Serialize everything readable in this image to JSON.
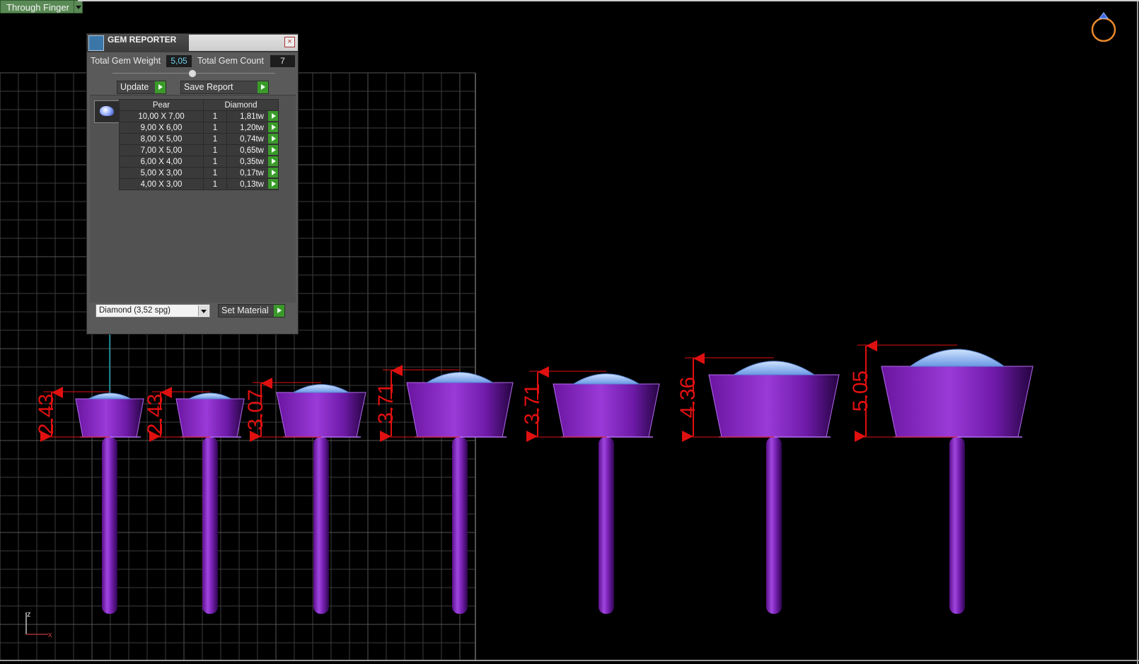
{
  "toolbar": {
    "mode": "Through Finger"
  },
  "panel": {
    "title": "GEM REPORTER",
    "total_weight_label": "Total Gem Weight",
    "total_weight": "5,05",
    "total_count_label": "Total Gem Count",
    "total_count": "7",
    "update_label": "Update",
    "save_report_label": "Save Report",
    "table": {
      "header_shape": "Pear",
      "header_material": "Diamond",
      "rows": [
        {
          "size": "10,00 X 7,00",
          "qty": "1",
          "weight": "1,81tw"
        },
        {
          "size": "9,00 X 6,00",
          "qty": "1",
          "weight": "1,20tw"
        },
        {
          "size": "8,00 X 5,00",
          "qty": "1",
          "weight": "0,74tw"
        },
        {
          "size": "7,00 X 5,00",
          "qty": "1",
          "weight": "0,65tw"
        },
        {
          "size": "6,00 X 4,00",
          "qty": "1",
          "weight": "0,35tw"
        },
        {
          "size": "5,00 X 3,00",
          "qty": "1",
          "weight": "0,17tw"
        },
        {
          "size": "4,00 X 3,00",
          "qty": "1",
          "weight": "0,13tw"
        }
      ]
    },
    "material_select": "Diamond   (3,52 spg)",
    "set_material_label": "Set Material"
  },
  "viewport": {
    "dimensions": [
      "2.43",
      "2.43",
      "3.07",
      "3.71",
      "3.71",
      "4.36",
      "5.05"
    ],
    "axis_x": "x",
    "axis_z": "z"
  },
  "colors": {
    "metal": "#8a1fc0",
    "gem": "#8fb8f5",
    "dimension": "#e01010",
    "grid": "#3c3c3c"
  }
}
